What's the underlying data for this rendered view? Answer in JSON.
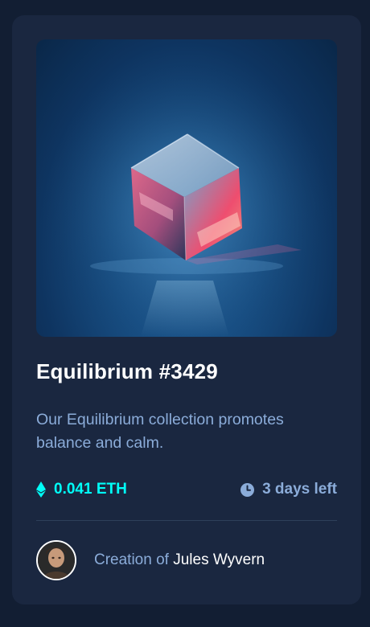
{
  "card": {
    "image_alt": "Equilibrium glowing cube",
    "title": "Equilibrium #3429",
    "description": "Our Equilibrium collection promotes balance and calm.",
    "price": "0.041 ETH",
    "time_left": "3 days left",
    "creator_prefix": "Creation of",
    "creator_name": "Jules Wyvern"
  },
  "icons": {
    "price": "ethereum-icon",
    "time": "clock-icon",
    "avatar": "avatar-portrait"
  },
  "colors": {
    "page_bg": "#121e33",
    "card_bg": "#1a2740",
    "accent_cyan": "#00fff8",
    "soft_blue": "#8bacd9",
    "white": "#ffffff",
    "divider": "#2e405a"
  }
}
